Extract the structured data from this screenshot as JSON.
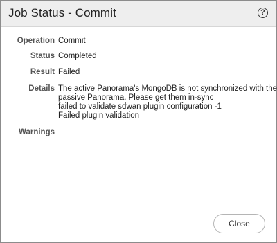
{
  "dialog": {
    "title": "Job Status - Commit",
    "help_symbol": "?",
    "fields": {
      "operation": {
        "label": "Operation",
        "value": "Commit"
      },
      "status": {
        "label": "Status",
        "value": "Completed"
      },
      "result": {
        "label": "Result",
        "value": "Failed"
      },
      "details": {
        "label": "Details",
        "lines": [
          "The active Panorama's MongoDB is not synchronized with the",
          "passive Panorama. Please get them in-sync",
          "failed to validate sdwan plugin configuration -1",
          "Failed plugin validation"
        ]
      },
      "warnings": {
        "label": "Warnings",
        "value": ""
      }
    },
    "close_label": "Close"
  }
}
